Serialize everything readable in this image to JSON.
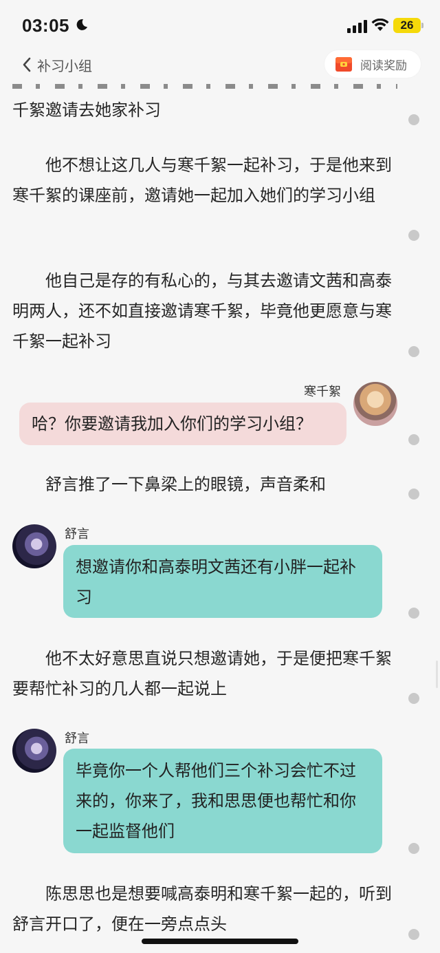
{
  "status_bar": {
    "time": "03:05",
    "battery": "26"
  },
  "nav": {
    "back_label": "补习小组",
    "reward_label": "阅读奖励"
  },
  "content": {
    "top_fragment": "千絮邀请去她家补习",
    "p1": "　　他不想让这几人与寒千絮一起补习，于是他来到寒千絮的课座前，邀请她一起加入她们的学习小组",
    "p2": "　　他自己是存的有私心的，与其去邀请文茜和高泰明两人，还不如直接邀请寒千絮，毕竟他更愿意与寒千絮一起补习",
    "chat1": {
      "name": "寒千絮",
      "text": "哈？你要邀请我加入你们的学习小组？"
    },
    "p3": "　　舒言推了一下鼻梁上的眼镜，声音柔和",
    "chat2": {
      "name": "舒言",
      "text": "想邀请你和高泰明文茜还有小胖一起补习"
    },
    "p4": "　　他不太好意思直说只想邀请她，于是便把寒千絮要帮忙补习的几人都一起说上",
    "chat3": {
      "name": "舒言",
      "text": "毕竟你一个人帮他们三个补习会忙不过来的，你来了，我和思思便也帮忙和你一起监督他们"
    },
    "p5": "　　陈思思也是想要喊高泰明和寒千絮一起的，听到舒言开口了，便在一旁点点头"
  },
  "colors": {
    "pink_bubble": "#f4dada",
    "teal_bubble": "#8ad8d0",
    "battery": "#f5d90a"
  },
  "icons": [
    "moon-icon",
    "signal-icon",
    "wifi-icon",
    "back-chevron-icon",
    "gift-icon",
    "comment-dot-icon"
  ]
}
